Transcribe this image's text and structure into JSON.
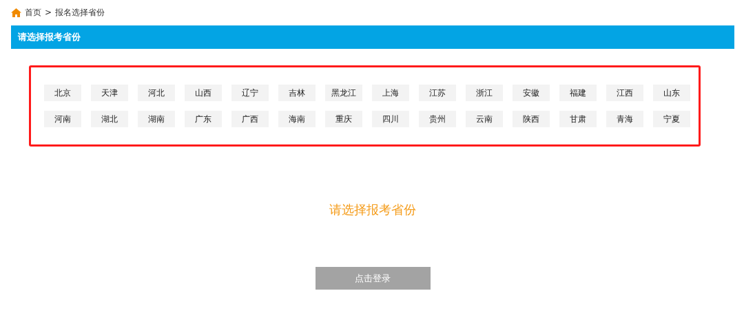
{
  "breadcrumb": {
    "items": [
      "首页",
      "报名选择省份"
    ],
    "separator": ">"
  },
  "header": {
    "title": "请选择报考省份"
  },
  "province_panel": {
    "highlighted": true,
    "provinces": [
      {
        "label": "北京",
        "selected": false
      },
      {
        "label": "天津",
        "selected": false
      },
      {
        "label": "河北",
        "selected": false
      },
      {
        "label": "山西",
        "selected": false
      },
      {
        "label": "辽宁",
        "selected": false
      },
      {
        "label": "吉林",
        "selected": false
      },
      {
        "label": "黑龙江",
        "selected": false
      },
      {
        "label": "上海",
        "selected": false
      },
      {
        "label": "江苏",
        "selected": false
      },
      {
        "label": "浙江",
        "selected": false
      },
      {
        "label": "安徽",
        "selected": false
      },
      {
        "label": "福建",
        "selected": false
      },
      {
        "label": "江西",
        "selected": false
      },
      {
        "label": "山东",
        "selected": false
      },
      {
        "label": "河南",
        "selected": false
      },
      {
        "label": "湖北",
        "selected": false
      },
      {
        "label": "湖南",
        "selected": false
      },
      {
        "label": "广东",
        "selected": false
      },
      {
        "label": "广西",
        "selected": false
      },
      {
        "label": "海南",
        "selected": false
      },
      {
        "label": "重庆",
        "selected": false
      },
      {
        "label": "四川",
        "selected": false
      },
      {
        "label": "贵州",
        "selected": false
      },
      {
        "label": "云南",
        "selected": false
      },
      {
        "label": "陕西",
        "selected": false
      },
      {
        "label": "甘肃",
        "selected": false
      },
      {
        "label": "青海",
        "selected": false
      },
      {
        "label": "宁夏",
        "selected": false
      }
    ]
  },
  "message": "请选择报考省份",
  "login_button": {
    "label": "点击登录",
    "disabled": true
  }
}
